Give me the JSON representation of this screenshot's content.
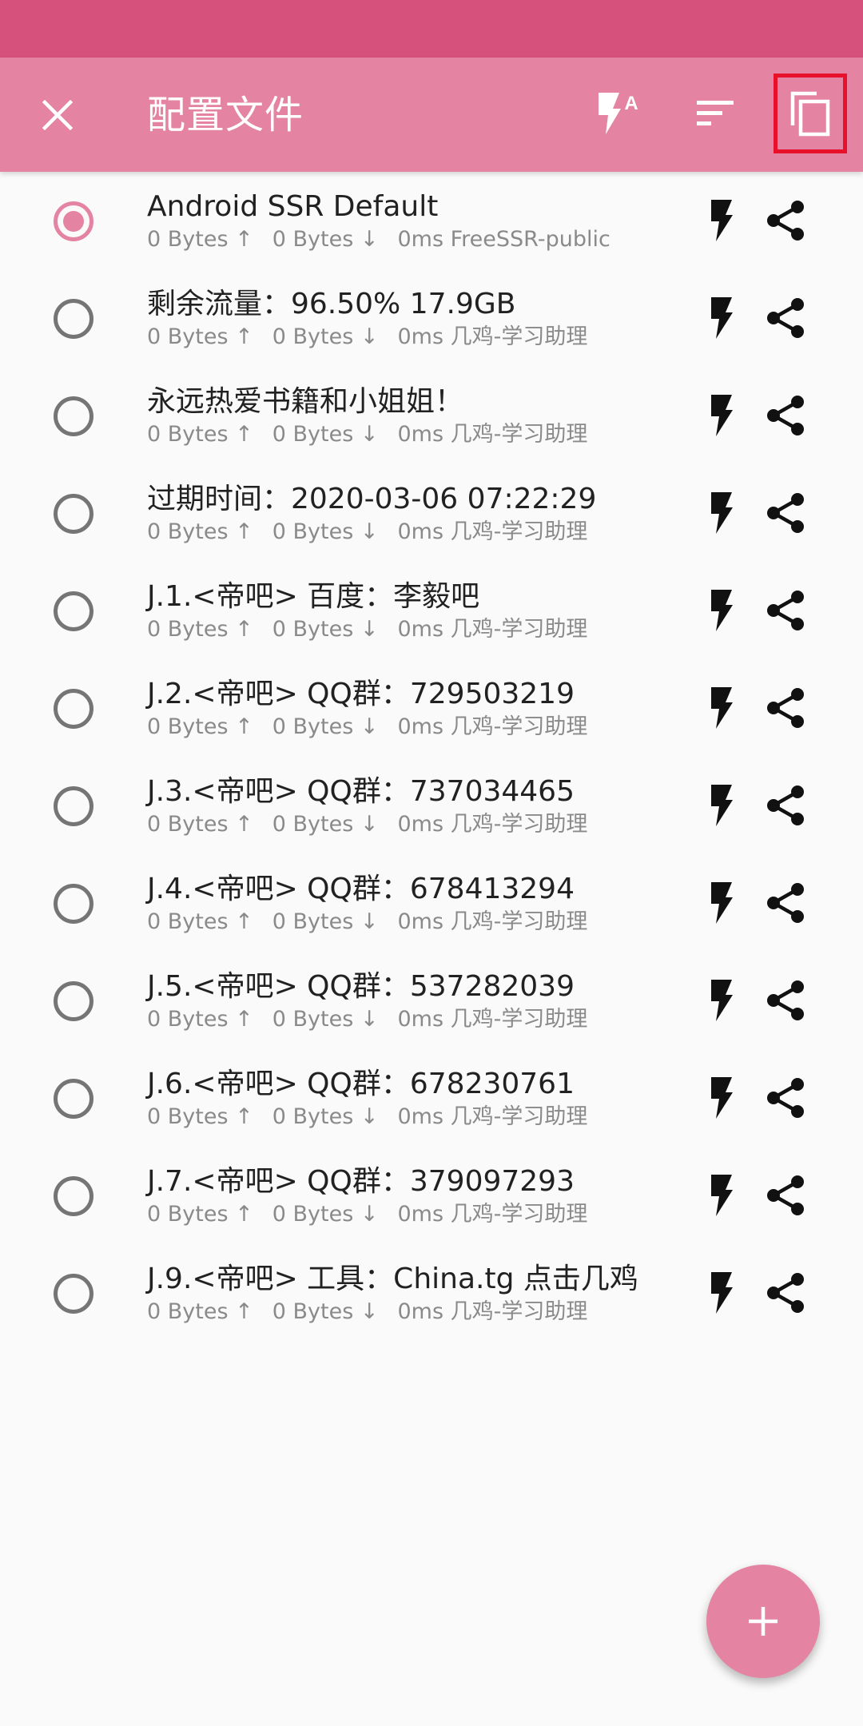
{
  "colors": {
    "status_bar": "#d6517b",
    "app_bar": "#e483a2",
    "accent": "#e483a2",
    "highlight_box": "#e8102a"
  },
  "toolbar": {
    "title": "配置文件",
    "close_icon": "close-icon",
    "test_all_icon": "flash-auto-icon",
    "sort_icon": "sort-icon",
    "copy_icon": "copy-icon"
  },
  "profiles": [
    {
      "title": "Android SSR Default",
      "upload": "0 Bytes ↑",
      "download": "0 Bytes ↓",
      "detail": "0ms FreeSSR-public",
      "selected": true
    },
    {
      "title": "剩余流量：96.50% 17.9GB",
      "upload": "0 Bytes ↑",
      "download": "0 Bytes ↓",
      "detail": "0ms 几鸡-学习助理",
      "selected": false
    },
    {
      "title": "永远热爱书籍和小姐姐！",
      "upload": "0 Bytes ↑",
      "download": "0 Bytes ↓",
      "detail": "0ms 几鸡-学习助理",
      "selected": false
    },
    {
      "title": "过期时间：2020-03-06 07:22:29",
      "upload": "0 Bytes ↑",
      "download": "0 Bytes ↓",
      "detail": "0ms 几鸡-学习助理",
      "selected": false
    },
    {
      "title": "J.1.<帝吧> 百度：李毅吧",
      "upload": "0 Bytes ↑",
      "download": "0 Bytes ↓",
      "detail": "0ms 几鸡-学习助理",
      "selected": false
    },
    {
      "title": "J.2.<帝吧> QQ群：729503219",
      "upload": "0 Bytes ↑",
      "download": "0 Bytes ↓",
      "detail": "0ms 几鸡-学习助理",
      "selected": false
    },
    {
      "title": "J.3.<帝吧> QQ群：737034465",
      "upload": "0 Bytes ↑",
      "download": "0 Bytes ↓",
      "detail": "0ms 几鸡-学习助理",
      "selected": false
    },
    {
      "title": "J.4.<帝吧> QQ群：678413294",
      "upload": "0 Bytes ↑",
      "download": "0 Bytes ↓",
      "detail": "0ms 几鸡-学习助理",
      "selected": false
    },
    {
      "title": "J.5.<帝吧> QQ群：537282039",
      "upload": "0 Bytes ↑",
      "download": "0 Bytes ↓",
      "detail": "0ms 几鸡-学习助理",
      "selected": false
    },
    {
      "title": "J.6.<帝吧> QQ群：678230761",
      "upload": "0 Bytes ↑",
      "download": "0 Bytes ↓",
      "detail": "0ms 几鸡-学习助理",
      "selected": false
    },
    {
      "title": "J.7.<帝吧> QQ群：379097293",
      "upload": "0 Bytes ↑",
      "download": "0 Bytes ↓",
      "detail": "0ms 几鸡-学习助理",
      "selected": false
    },
    {
      "title": "J.9.<帝吧> 工具：China.tg 点击几鸡",
      "upload": "0 Bytes ↑",
      "download": "0 Bytes ↓",
      "detail": "0ms 几鸡-学习助理",
      "selected": false
    }
  ],
  "row_icons": {
    "test": "flash-icon",
    "share": "share-icon"
  },
  "fab": {
    "label": "+",
    "icon": "add-icon"
  }
}
